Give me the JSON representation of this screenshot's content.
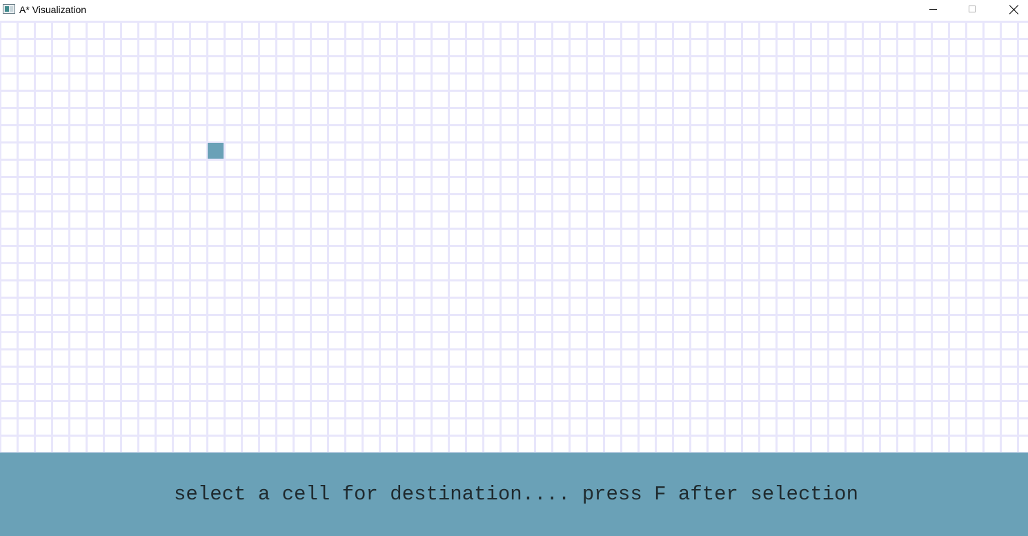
{
  "window": {
    "title": "A* Visualization",
    "icon": "app-window-icon"
  },
  "titlebar_buttons": {
    "minimize_icon": "minimize-icon",
    "maximize_icon": "maximize-icon",
    "close_icon": "close-icon"
  },
  "grid": {
    "selected_cell_color": "#6aa1b7",
    "line_color": "#e8e6fb"
  },
  "status": {
    "message": "select a cell for destination.... press F after selection",
    "background_color": "#6aa1b7"
  }
}
